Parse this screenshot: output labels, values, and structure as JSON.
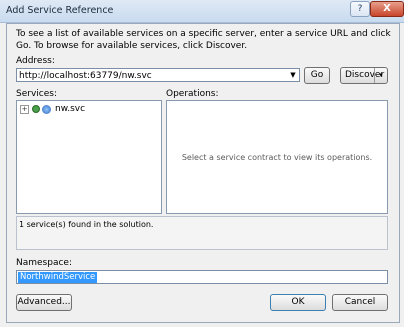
{
  "window": {
    "title": "Add Service Reference",
    "help_label": "?",
    "close_label": "X"
  },
  "instructions": "To see a list of available services on a specific server, enter a service URL and click Go. To browse for available services, click Discover.",
  "address": {
    "label": "Address:",
    "value": "http://localhost:63779/nw.svc",
    "dropdown_glyph": "▼"
  },
  "buttons": {
    "go": "Go",
    "discover": "Discover",
    "discover_arrow": "▾",
    "advanced": "Advanced...",
    "ok": "OK",
    "cancel": "Cancel"
  },
  "services": {
    "label": "Services:",
    "items": [
      {
        "expander": "+",
        "label": "nw.svc"
      }
    ]
  },
  "operations": {
    "label": "Operations:",
    "hint": "Select a service contract to view its operations."
  },
  "status": {
    "text": "1 service(s) found in the solution."
  },
  "namespace": {
    "label": "Namespace:",
    "value": "NorthwindService"
  }
}
